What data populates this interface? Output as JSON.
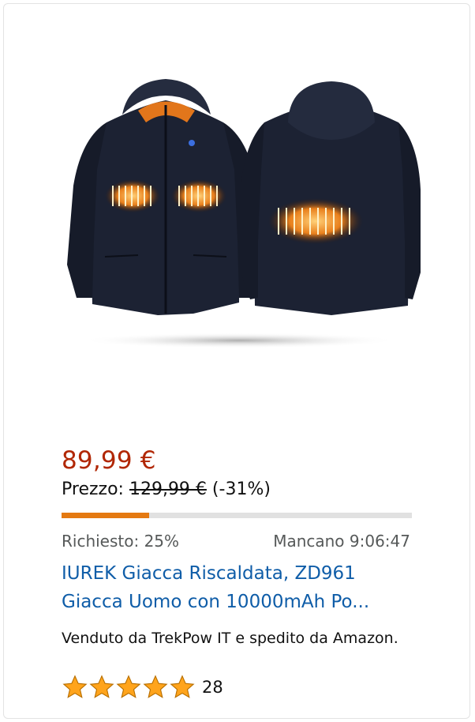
{
  "product": {
    "image_alt": "heated-jacket-front-and-back",
    "deal_price": "89,99 €",
    "list_price_label": "Prezzo:",
    "list_price": "129,99 €",
    "discount": "(-31%)",
    "claimed_text": "Richiesto: 25%",
    "claimed_fraction": 0.25,
    "time_left": "Mancano 9:06:47",
    "title_line1": "IUREK Giacca Riscaldata, ZD961",
    "title_line2": "Giacca Uomo con 10000mAh Po...",
    "seller_text": "Venduto da TrekPow IT e spedito da Amazon.",
    "rating_stars": 5,
    "rating_count": "28"
  },
  "colors": {
    "price": "#B12704",
    "link": "#0F5DA8",
    "progress": "#E47911",
    "star": "#FFA41C"
  }
}
